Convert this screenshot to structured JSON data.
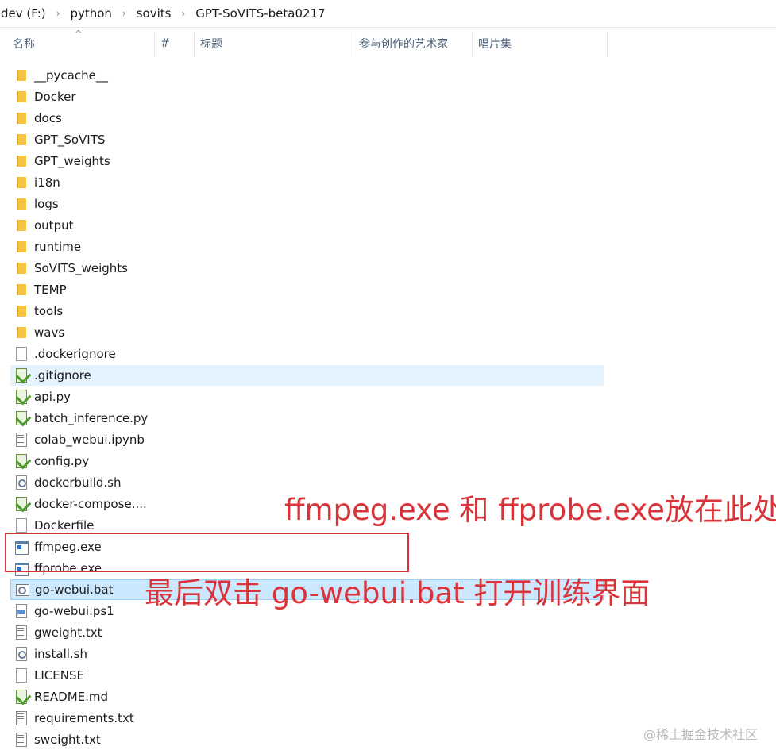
{
  "breadcrumb": {
    "items": [
      "dev (F:)",
      "python",
      "sovits",
      "GPT-SoVITS-beta0217"
    ],
    "separator": "›"
  },
  "columns": {
    "name": "名称",
    "number": "#",
    "title": "标题",
    "artists": "参与创作的艺术家",
    "album": "唱片集"
  },
  "files": [
    {
      "name": "__pycache__",
      "icon": "folder-icon"
    },
    {
      "name": "Docker",
      "icon": "folder-icon"
    },
    {
      "name": "docs",
      "icon": "folder-icon"
    },
    {
      "name": "GPT_SoVITS",
      "icon": "folder-icon"
    },
    {
      "name": "GPT_weights",
      "icon": "folder-icon"
    },
    {
      "name": "i18n",
      "icon": "folder-icon"
    },
    {
      "name": "logs",
      "icon": "folder-icon"
    },
    {
      "name": "output",
      "icon": "folder-icon"
    },
    {
      "name": "runtime",
      "icon": "folder-icon"
    },
    {
      "name": "SoVITS_weights",
      "icon": "folder-icon"
    },
    {
      "name": "TEMP",
      "icon": "folder-icon"
    },
    {
      "name": "tools",
      "icon": "folder-icon"
    },
    {
      "name": "wavs",
      "icon": "folder-icon"
    },
    {
      "name": ".dockerignore",
      "icon": "blank-file-icon"
    },
    {
      "name": ".gitignore",
      "icon": "notepad-file-icon"
    },
    {
      "name": "api.py",
      "icon": "notepad-file-icon"
    },
    {
      "name": "batch_inference.py",
      "icon": "notepad-file-icon"
    },
    {
      "name": "colab_webui.ipynb",
      "icon": "text-file-icon"
    },
    {
      "name": "config.py",
      "icon": "notepad-file-icon"
    },
    {
      "name": "dockerbuild.sh",
      "icon": "script-file-icon"
    },
    {
      "name": "docker-compose....",
      "icon": "notepad-file-icon"
    },
    {
      "name": "Dockerfile",
      "icon": "blank-file-icon"
    },
    {
      "name": "ffmpeg.exe",
      "icon": "application-icon"
    },
    {
      "name": "ffprobe.exe",
      "icon": "application-icon"
    },
    {
      "name": "go-webui.bat",
      "icon": "batch-file-icon"
    },
    {
      "name": "go-webui.ps1",
      "icon": "powershell-file-icon"
    },
    {
      "name": "gweight.txt",
      "icon": "text-file-icon"
    },
    {
      "name": "install.sh",
      "icon": "script-file-icon"
    },
    {
      "name": "LICENSE",
      "icon": "blank-file-icon"
    },
    {
      "name": "README.md",
      "icon": "notepad-file-icon"
    },
    {
      "name": "requirements.txt",
      "icon": "text-file-icon"
    },
    {
      "name": "sweight.txt",
      "icon": "text-file-icon"
    }
  ],
  "annotations": {
    "line1": "ffmpeg.exe 和  ffprobe.exe放在此处",
    "line2": "最后双击 go-webui.bat 打开训练界面"
  },
  "watermark": "@稀土掘金技术社区",
  "colors": {
    "annotation": "#d9343a",
    "selected_row": "#cce8ff",
    "hover_row": "#e5f3ff"
  }
}
